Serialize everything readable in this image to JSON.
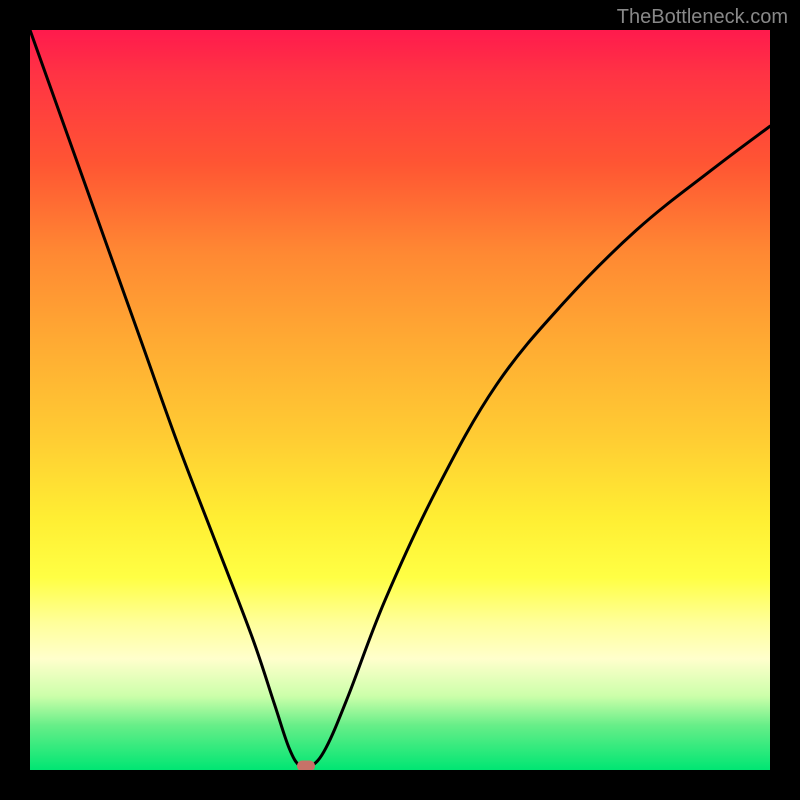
{
  "watermark": "TheBottleneck.com",
  "chart_data": {
    "type": "line",
    "title": "",
    "xlabel": "",
    "ylabel": "",
    "xlim": [
      0,
      100
    ],
    "ylim": [
      0,
      100
    ],
    "series": [
      {
        "name": "bottleneck-curve",
        "x": [
          0,
          5,
          10,
          15,
          20,
          25,
          30,
          33,
          35,
          36.5,
          38,
          40,
          43,
          48,
          55,
          63,
          72,
          82,
          92,
          100
        ],
        "values": [
          100,
          86,
          72,
          58,
          44,
          31,
          18,
          9,
          3,
          0.5,
          0.5,
          3,
          10,
          23,
          38,
          52,
          63,
          73,
          81,
          87
        ]
      }
    ],
    "min_point": {
      "x": 37.3,
      "y": 0.5
    },
    "gradient_stops": [
      {
        "pos": 0,
        "color": "#ff1a4d"
      },
      {
        "pos": 50,
        "color": "#ffcc33"
      },
      {
        "pos": 80,
        "color": "#ffff99"
      },
      {
        "pos": 100,
        "color": "#00e673"
      }
    ]
  }
}
